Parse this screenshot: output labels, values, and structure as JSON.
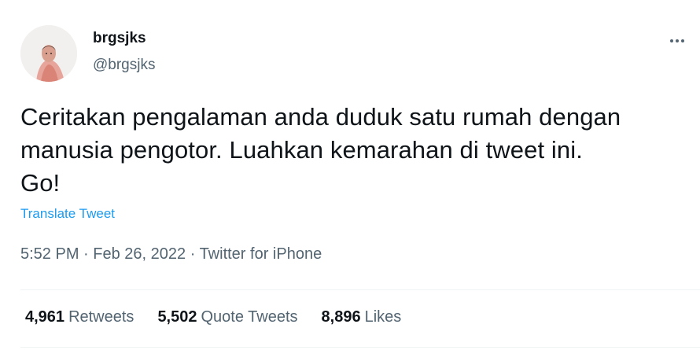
{
  "author": {
    "display_name": "brgsjks",
    "handle": "@brgsjks",
    "avatar_icon": "profile-photo"
  },
  "menu": {
    "icon": "more-horizontal-icon"
  },
  "tweet": {
    "lines": [
      "Ceritakan pengalaman anda duduk satu rumah dengan",
      "manusia pengotor. Luahkan kemarahan di tweet ini.",
      "Go!"
    ],
    "translate_label": "Translate Tweet"
  },
  "meta": {
    "time": "5:52 PM",
    "separator": "·",
    "date": "Feb 26, 2022",
    "source": "Twitter for iPhone"
  },
  "stats": {
    "retweets": {
      "count": "4,961",
      "label": "Retweets"
    },
    "quotes": {
      "count": "5,502",
      "label": "Quote Tweets"
    },
    "likes": {
      "count": "8,896",
      "label": "Likes"
    }
  },
  "colors": {
    "link": "#1d9bf0",
    "text": "#0f1419",
    "secondary": "#536471",
    "divider": "#eff3f4"
  }
}
